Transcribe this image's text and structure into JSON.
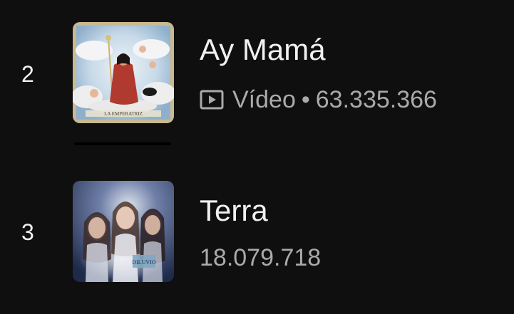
{
  "items": [
    {
      "rank": "2",
      "title": "Ay Mamá",
      "type_label": "Vídeo",
      "separator": "•",
      "views": "63.335.366",
      "thumbnail": {
        "icon": "album-art-ay-mama",
        "caption": "LA EMPERATRIZ",
        "frame_color": "#c9b98f",
        "sky_color": "#b8d0e6",
        "robe_color": "#b03a2e"
      }
    },
    {
      "rank": "3",
      "title": "Terra",
      "views": "18.079.718",
      "thumbnail": {
        "icon": "album-art-terra",
        "caption": "DILUVIO",
        "bg_color": "#2c3c63",
        "glow_color": "#e9e3ee"
      }
    }
  ],
  "colors": {
    "background": "#0f0f0f",
    "primary_text": "#f1f1f1",
    "secondary_text": "#aaaaaa"
  }
}
